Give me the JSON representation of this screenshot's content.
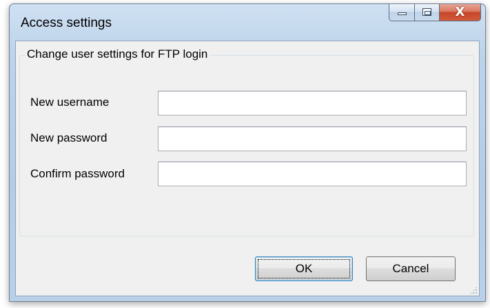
{
  "window": {
    "title": "Access settings",
    "controls": {
      "minimize": "minimize",
      "maximize": "maximize",
      "close": "X"
    }
  },
  "group": {
    "legend": "Change user settings for FTP login",
    "fields": [
      {
        "label": "New username",
        "value": "",
        "placeholder": ""
      },
      {
        "label": "New password",
        "value": "",
        "placeholder": ""
      },
      {
        "label": "Confirm password",
        "value": "",
        "placeholder": ""
      }
    ]
  },
  "buttons": {
    "ok": "OK",
    "cancel": "Cancel"
  },
  "colors": {
    "title_bar": "#bcd3ea",
    "close_button": "#c7452a",
    "client_background": "#f0f0f0",
    "default_button_border": "#3c7fb1"
  }
}
